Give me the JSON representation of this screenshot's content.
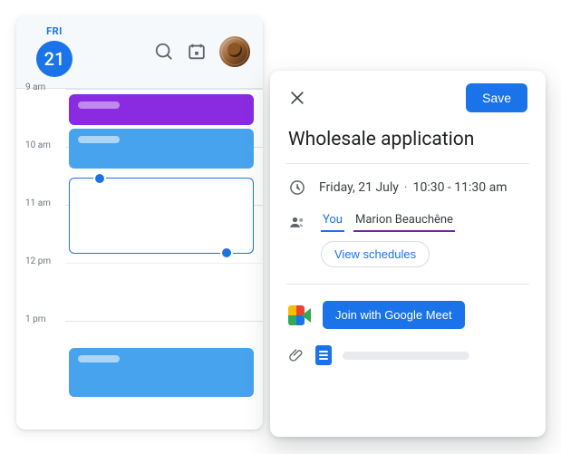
{
  "calendar": {
    "day_label": "FRI",
    "date_number": "21",
    "hours": [
      "9 am",
      "10 am",
      "11 am",
      "12 pm",
      "1 pm"
    ]
  },
  "panel": {
    "save_label": "Save",
    "title": "Wholesale application",
    "date_text": "Friday, 21 July",
    "time_text": "10:30 - 11:30 am",
    "separator": "·",
    "you_label": "You",
    "attendee_name": "Marion Beauchêne",
    "view_schedules_label": "View schedules",
    "meet_label": "Join with Google Meet"
  }
}
